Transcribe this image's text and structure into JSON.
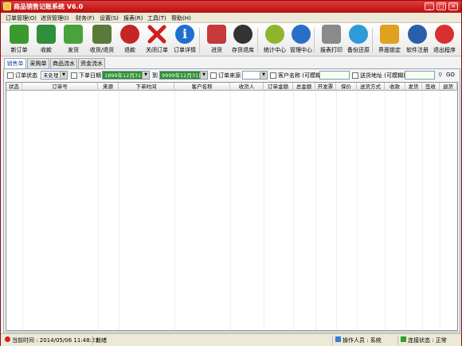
{
  "window": {
    "title": "商品销售记账系统 V6.0",
    "min_label": "_",
    "max_label": "□",
    "close_label": "×"
  },
  "menu": [
    "订单管理(O)",
    "进货管理(I)",
    "财务(F)",
    "设置(S)",
    "报表(R)",
    "工具(T)",
    "帮助(H)"
  ],
  "toolbar": [
    {
      "label": "新订单",
      "icon": "new-order-icon",
      "color": "#3a9a2e"
    },
    {
      "label": "收款",
      "icon": "receive-money-icon",
      "color": "#2f8f3a"
    },
    {
      "label": "发货",
      "icon": "truck-icon",
      "color": "#49a23a"
    },
    {
      "label": "收货/退货",
      "icon": "check-box-icon",
      "color": "#5a7a3a"
    },
    {
      "label": "退款",
      "icon": "refund-icon",
      "color": "#c52525"
    },
    {
      "label": "关闭订单",
      "icon": "close-x-icon",
      "color": "#d21e1e"
    },
    {
      "label": "订单详情",
      "icon": "info-icon",
      "color": "#1f6fd0"
    },
    {
      "label": "进货",
      "icon": "basket-icon",
      "color": "#c63a3a"
    },
    {
      "label": "存货退库",
      "icon": "return-stock-icon",
      "color": "#333333"
    },
    {
      "label": "统计中心",
      "icon": "statistics-icon",
      "color": "#8fb52a"
    },
    {
      "label": "管理中心",
      "icon": "gear-icon",
      "color": "#2a6fc7"
    },
    {
      "label": "报表打印",
      "icon": "printer-icon",
      "color": "#8a8a8a"
    },
    {
      "label": "备份还原",
      "icon": "backup-icon",
      "color": "#2e9ad8"
    },
    {
      "label": "界面锁定",
      "icon": "lock-icon",
      "color": "#e0a020"
    },
    {
      "label": "软件注册",
      "icon": "register-icon",
      "color": "#2a5fa8"
    },
    {
      "label": "退出程序",
      "icon": "power-icon",
      "color": "#d83030"
    }
  ],
  "tabs": [
    "销售单",
    "采购单",
    "商品流水",
    "资金流水"
  ],
  "filters": {
    "order_status_label": "订单状态",
    "order_status_value": "未处理",
    "order_date_label": "下单日期",
    "date_from": "1899年12月31日",
    "to_label": "到",
    "date_to": "9999年12月31日",
    "order_source_label": "订单来源",
    "customer_label": "客户名称 (可模糊)",
    "address_label": "送货地址 (可模糊)",
    "search_icon": "search-icon",
    "search_label": "GO"
  },
  "columns": [
    "状态",
    "订单号",
    "来源",
    "下单时间",
    "客户名称",
    "收货人",
    "订单金额",
    "总金额",
    "开发票",
    "保价",
    "送货方式",
    "收款",
    "发货",
    "签收",
    "退货"
  ],
  "status": {
    "time": "当前时间 : 2014/05/06  11:48:23",
    "state": "就绪",
    "operator": "操作人员 : 系统",
    "connection": "连接状态 : 正常"
  }
}
